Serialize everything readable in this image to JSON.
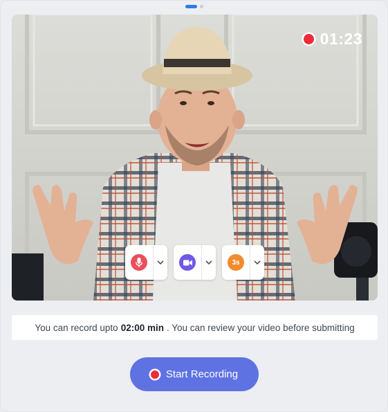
{
  "pager": {
    "count": 2,
    "active_index": 0
  },
  "video": {
    "recording": true,
    "timer": "01:23"
  },
  "controls": [
    {
      "icon": "microphone-icon",
      "color": "#ea4f5c",
      "label": ""
    },
    {
      "icon": "video-camera-icon",
      "color": "#7357e8",
      "label": ""
    },
    {
      "icon": "countdown-icon",
      "color": "#f28a2e",
      "label": "3s"
    }
  ],
  "info": {
    "prefix": "You can record upto",
    "limit": "02:00 min",
    "suffix": ". You can review your video before submitting"
  },
  "start_button": {
    "label": "Start Recording"
  },
  "colors": {
    "accent": "#5f72e2",
    "record": "#ee2b39",
    "pager_active": "#2f7bea"
  }
}
